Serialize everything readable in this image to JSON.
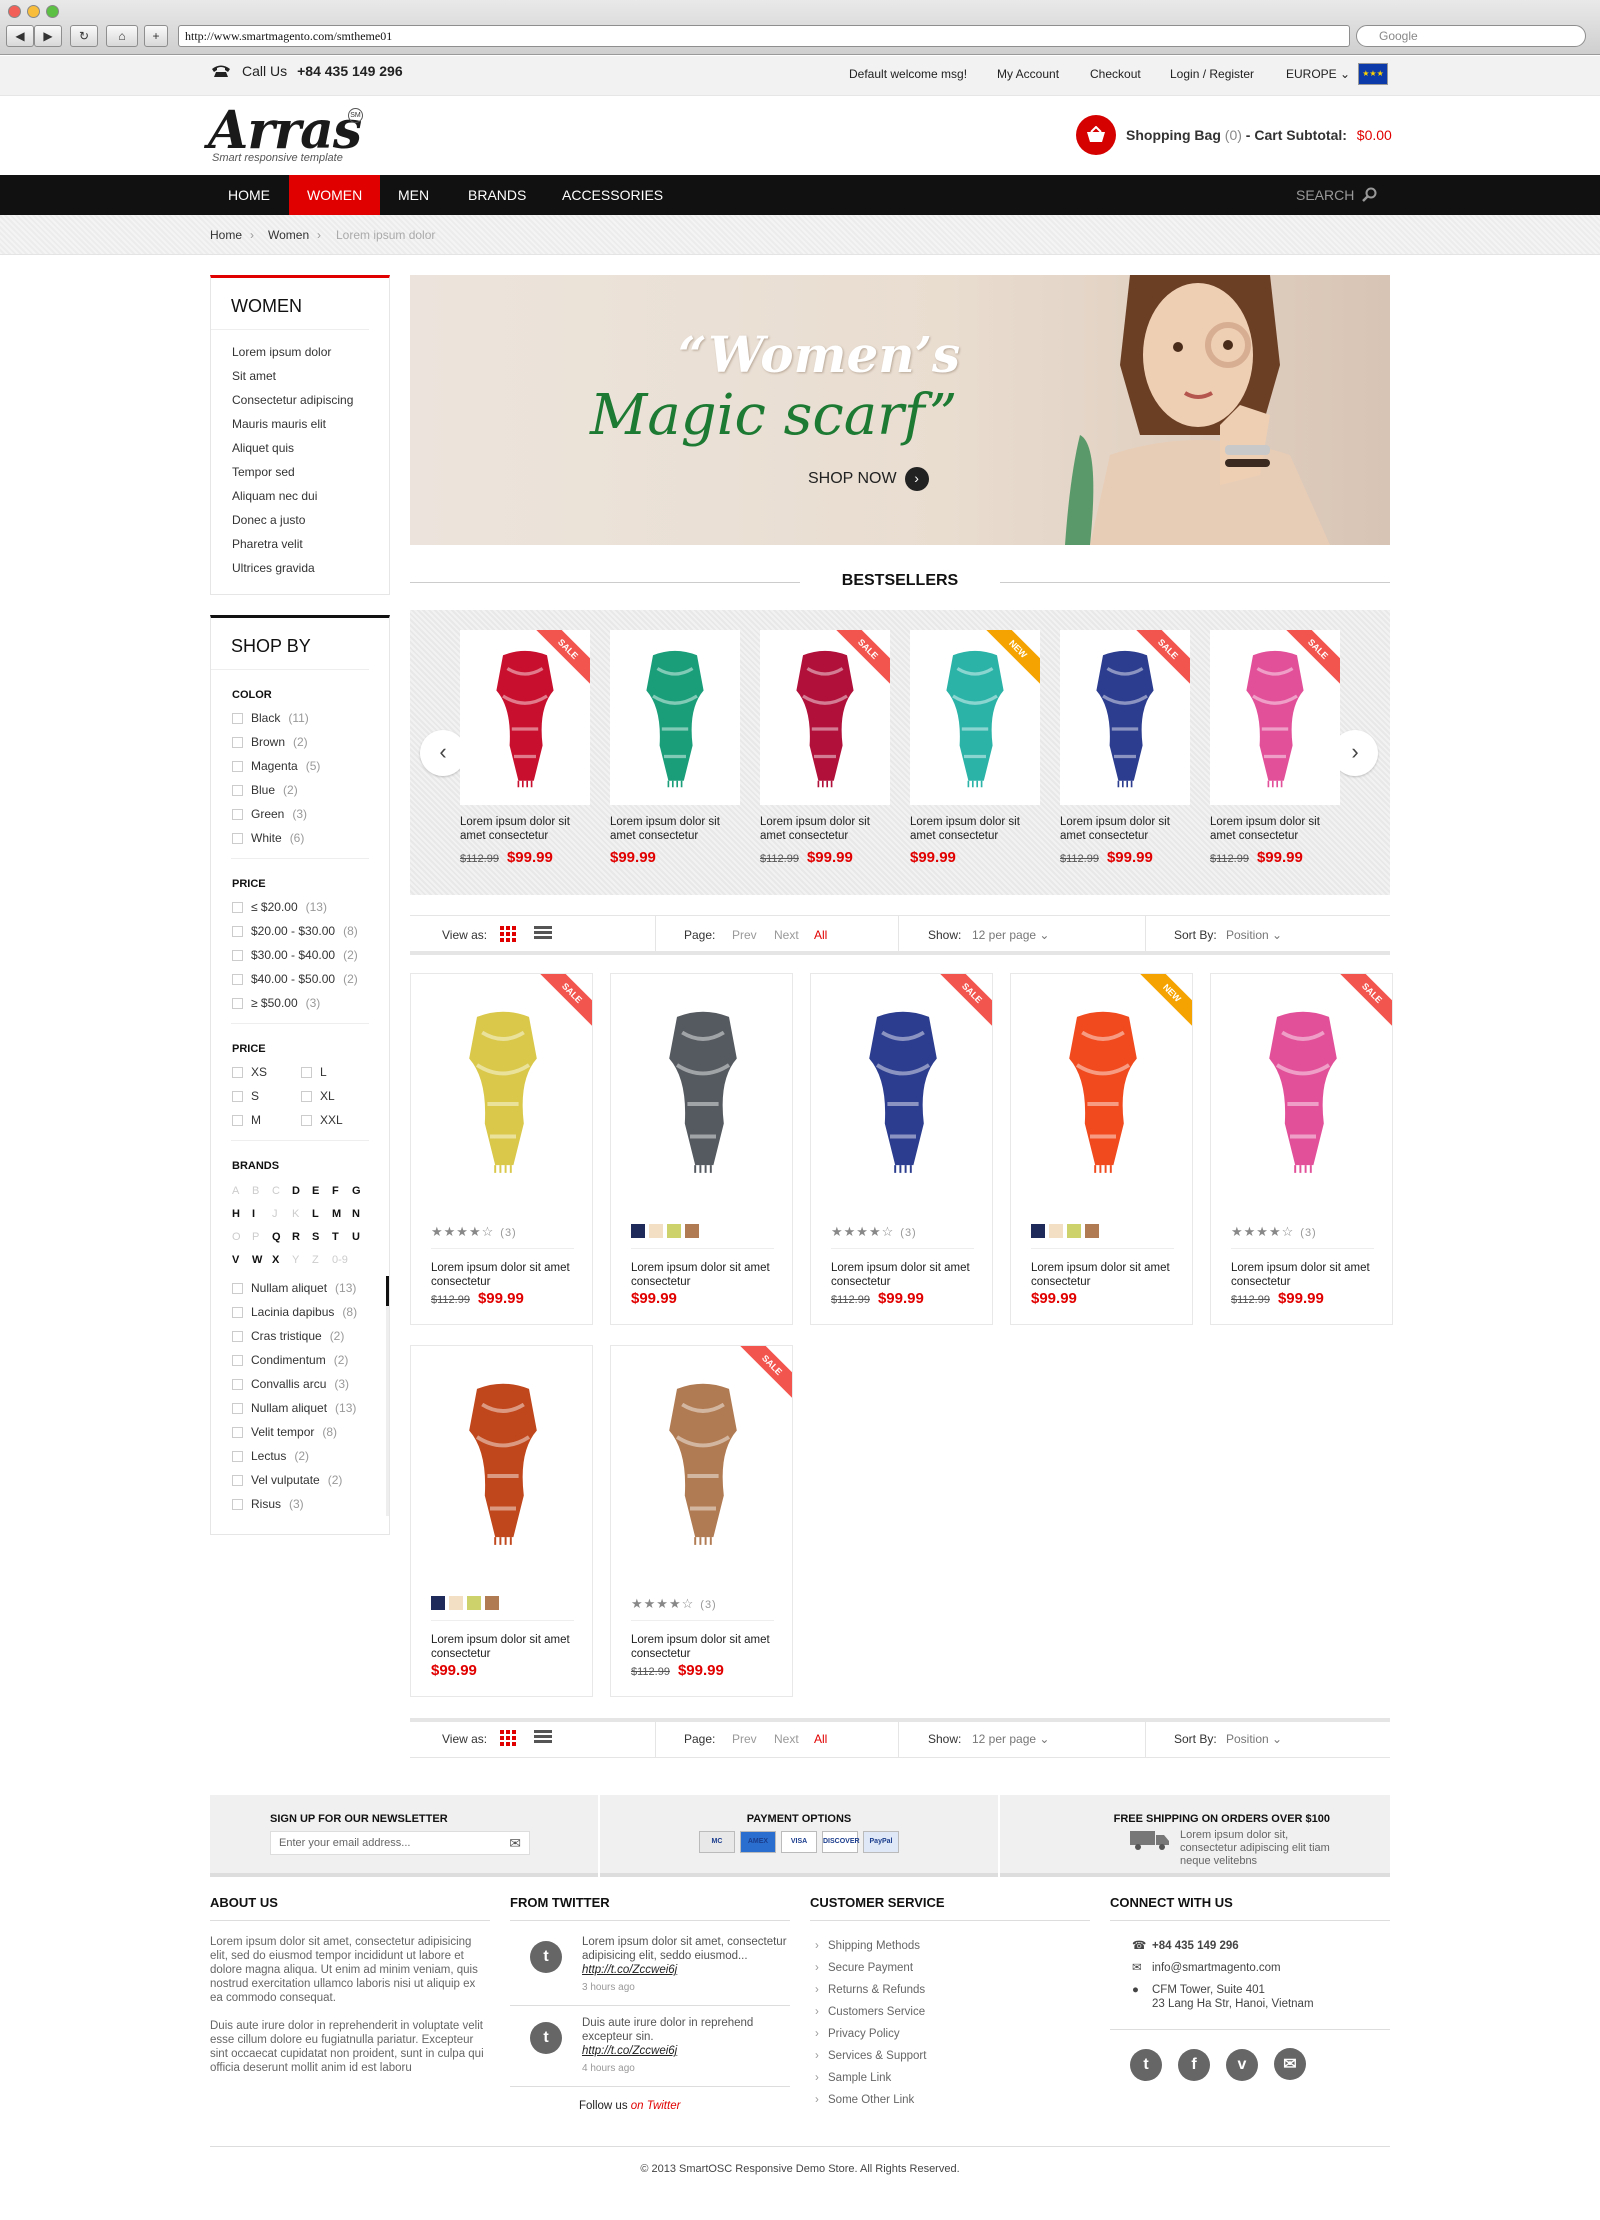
{
  "browser": {
    "url": "http://www.smartmagento.com/smtheme01",
    "search_placeholder": "Google"
  },
  "topbar": {
    "call_label": "Call Us",
    "phone": "+84 435 149 296",
    "welcome": "Default welcome msg!",
    "links": [
      "My Account",
      "Checkout",
      "Login / Register"
    ],
    "region": "EUROPE"
  },
  "header": {
    "logo": "Arras",
    "logo_badge": "SM",
    "tagline": "Smart responsive template",
    "bag_label": "Shopping Bag",
    "bag_count": "(0)",
    "subtotal_label": "- Cart Subtotal:",
    "subtotal_value": "$0.00"
  },
  "nav": {
    "items": [
      "HOME",
      "WOMEN",
      "MEN",
      "BRANDS",
      "ACCESSORIES"
    ],
    "active": "WOMEN",
    "search": "SEARCH"
  },
  "breadcrumb": [
    "Home",
    "Women",
    "Lorem ipsum dolor"
  ],
  "sidebar": {
    "women_title": "WOMEN",
    "categories": [
      "Lorem ipsum dolor",
      "Sit amet",
      "Consectetur adipiscing",
      "Mauris mauris elit",
      "Aliquet quis",
      "Tempor sed",
      "Aliquam nec dui",
      "Donec a justo",
      "Pharetra velit",
      "Ultrices gravida"
    ],
    "shopby_title": "SHOP BY",
    "color_title": "COLOR",
    "colors": [
      [
        "Black",
        "(11)"
      ],
      [
        "Brown",
        "(2)"
      ],
      [
        "Magenta",
        "(5)"
      ],
      [
        "Blue",
        "(2)"
      ],
      [
        "Green",
        "(3)"
      ],
      [
        "White",
        "(6)"
      ]
    ],
    "price_title": "PRICE",
    "prices": [
      [
        "≤ $20.00",
        "(13)"
      ],
      [
        "$20.00 - $30.00",
        "(8)"
      ],
      [
        "$30.00 - $40.00",
        "(2)"
      ],
      [
        "$40.00 - $50.00",
        "(2)"
      ],
      [
        "≥ $50.00",
        "(3)"
      ]
    ],
    "size_title": "PRICE",
    "sizes": [
      "XS",
      "L",
      "S",
      "XL",
      "M",
      "XXL"
    ],
    "brands_title": "BRANDS",
    "letters": [
      [
        "A",
        true
      ],
      [
        "B",
        true
      ],
      [
        "C",
        true
      ],
      [
        "D",
        false
      ],
      [
        "E",
        false
      ],
      [
        "F",
        false
      ],
      [
        "G",
        false
      ],
      [
        "H",
        false
      ],
      [
        "I",
        false
      ],
      [
        "J",
        true
      ],
      [
        "K",
        true
      ],
      [
        "L",
        false
      ],
      [
        "M",
        false
      ],
      [
        "N",
        false
      ],
      [
        "O",
        true
      ],
      [
        "P",
        true
      ],
      [
        "Q",
        false
      ],
      [
        "R",
        false
      ],
      [
        "S",
        false
      ],
      [
        "T",
        false
      ],
      [
        "U",
        false
      ],
      [
        "V",
        false
      ],
      [
        "W",
        false
      ],
      [
        "X",
        false
      ],
      [
        "Y",
        true
      ],
      [
        "Z",
        true
      ],
      [
        "0-9",
        true
      ]
    ],
    "brands": [
      [
        "Nullam aliquet",
        "(13)"
      ],
      [
        "Lacinia dapibus",
        "(8)"
      ],
      [
        "Cras tristique",
        "(2)"
      ],
      [
        "Condimentum",
        "(2)"
      ],
      [
        "Convallis arcu",
        "(3)"
      ],
      [
        "Nullam aliquet",
        "(13)"
      ],
      [
        "Velit tempor",
        "(8)"
      ],
      [
        "Lectus",
        "(2)"
      ],
      [
        "Vel vulputate",
        "(2)"
      ],
      [
        "Risus",
        "(3)"
      ]
    ]
  },
  "banner": {
    "title": "“Women’s",
    "subtitle": "Magic scarf”",
    "cta": "SHOP NOW"
  },
  "bestsellers": {
    "title": "BESTSELLERS",
    "items": [
      {
        "title": "Lorem ipsum dolor sit amet consectetur",
        "old": "$112.99",
        "price": "$99.99",
        "badge": "SALE",
        "color": "#c8102e"
      },
      {
        "title": "Lorem ipsum dolor sit amet consectetur",
        "old": "",
        "price": "$99.99",
        "badge": "",
        "color": "#1a9e7a"
      },
      {
        "title": "Lorem ipsum dolor sit amet consectetur",
        "old": "$112.99",
        "price": "$99.99",
        "badge": "SALE",
        "color": "#b0103a"
      },
      {
        "title": "Lorem ipsum dolor sit amet consectetur",
        "old": "",
        "price": "$99.99",
        "badge": "NEW",
        "color": "#2bb3a8"
      },
      {
        "title": "Lorem ipsum dolor sit amet consectetur",
        "old": "$112.99",
        "price": "$99.99",
        "badge": "SALE",
        "color": "#2c3d8f"
      },
      {
        "title": "Lorem ipsum dolor sit amet consectetur",
        "old": "$112.99",
        "price": "$99.99",
        "badge": "SALE",
        "color": "#e2509a"
      }
    ]
  },
  "toolbar": {
    "view_label": "View as:",
    "page_label": "Page:",
    "prev": "Prev",
    "next": "Next",
    "all": "All",
    "show_label": "Show:",
    "show_value": "12 per page",
    "sort_label": "Sort By:",
    "sort_value": "Position"
  },
  "products": [
    {
      "title": "Lorem ipsum dolor sit amet consectetur",
      "old": "$112.99",
      "price": "$99.99",
      "badge": "SALE",
      "rating": "★★★★☆",
      "reviews": "(3)",
      "swatches": [],
      "color": "#d9c84a"
    },
    {
      "title": "Lorem ipsum dolor sit amet consectetur",
      "old": "",
      "price": "$99.99",
      "badge": "",
      "rating": "",
      "reviews": "",
      "swatches": [
        "#1d2a5a",
        "#f3dfc4",
        "#cdd36a",
        "#b07a52"
      ],
      "color": "#555a60"
    },
    {
      "title": "Lorem ipsum dolor sit amet consectetur",
      "old": "$112.99",
      "price": "$99.99",
      "badge": "SALE",
      "rating": "★★★★☆",
      "reviews": "(3)",
      "swatches": [],
      "color": "#2c3d8f"
    },
    {
      "title": "Lorem ipsum dolor sit amet consectetur",
      "old": "",
      "price": "$99.99",
      "badge": "NEW",
      "rating": "",
      "reviews": "",
      "swatches": [
        "#1d2a5a",
        "#f3dfc4",
        "#cdd36a",
        "#b07a52"
      ],
      "color": "#f04a1e"
    },
    {
      "title": "Lorem ipsum dolor sit amet consectetur",
      "old": "$112.99",
      "price": "$99.99",
      "badge": "SALE",
      "rating": "★★★★☆",
      "reviews": "(3)",
      "swatches": [],
      "color": "#e2509a"
    },
    {
      "title": "Lorem ipsum dolor sit amet consectetur",
      "old": "",
      "price": "$99.99",
      "badge": "",
      "rating": "",
      "reviews": "",
      "swatches": [
        "#1d2a5a",
        "#f3dfc4",
        "#cdd36a",
        "#b07a52"
      ],
      "color": "#c0461b"
    },
    {
      "title": "Lorem ipsum dolor sit amet consectetur",
      "old": "$112.99",
      "price": "$99.99",
      "badge": "SALE",
      "rating": "★★★★☆",
      "reviews": "(3)",
      "swatches": [],
      "color": "#b07a52"
    }
  ],
  "footer": {
    "newsletter_title": "SIGN UP FOR OUR NEWSLETTER",
    "newsletter_placeholder": "Enter your email address...",
    "payment_title": "PAYMENT OPTIONS",
    "payment_cards": [
      "MC",
      "AMEX",
      "VISA",
      "DISCOVER",
      "PayPal"
    ],
    "shipping_title": "FREE SHIPPING ON ORDERS OVER $100",
    "shipping_text": "Lorem ipsum dolor sit, consectetur adipiscing elit tiam neque velitebns",
    "about_title": "ABOUT US",
    "about_p1": "Lorem ipsum dolor sit amet, consectetur adipisicing elit, sed do eiusmod tempor incididunt ut labore et dolore magna aliqua. Ut enim ad minim veniam, quis nostrud exercitation ullamco laboris nisi ut aliquip ex ea commodo consequat.",
    "about_p2": "Duis aute irure dolor in reprehenderit in voluptate velit esse cillum dolore eu fugiatnulla pariatur. Excepteur sint occaecat cupidatat non proident, sunt in culpa qui officia deserunt mollit anim id est laboru",
    "twitter_title": "FROM TWITTER",
    "tweets": [
      {
        "text": "Lorem ipsum dolor sit amet, consectetur adipisicing elit, seddo eiusmod...",
        "link": "http://t.co/Zccwei6j",
        "time": "3 hours ago"
      },
      {
        "text": "Duis aute irure dolor in reprehend excepteur sin.",
        "link": "http://t.co/Zccwei6j",
        "time": "4 hours ago"
      }
    ],
    "follow_label": "Follow us",
    "follow_link": "on Twitter",
    "service_title": "CUSTOMER SERVICE",
    "service_links": [
      "Shipping Methods",
      "Secure Payment",
      "Returns & Refunds",
      "Customers Service",
      "Privacy Policy",
      "Services & Support",
      "Sample Link",
      "Some Other Link"
    ],
    "connect_title": "CONNECT WITH US",
    "connect_phone": "+84 435 149 296",
    "connect_email": "info@smartmagento.com",
    "connect_addr1": "CFM Tower, Suite 401",
    "connect_addr2": "23 Lang Ha Str, Hanoi, Vietnam",
    "copyright": "© 2013 SmartOSC Responsive Demo Store. All Rights Reserved."
  },
  "colors": {
    "accent": "#e10000",
    "nav_bg": "#111111"
  }
}
